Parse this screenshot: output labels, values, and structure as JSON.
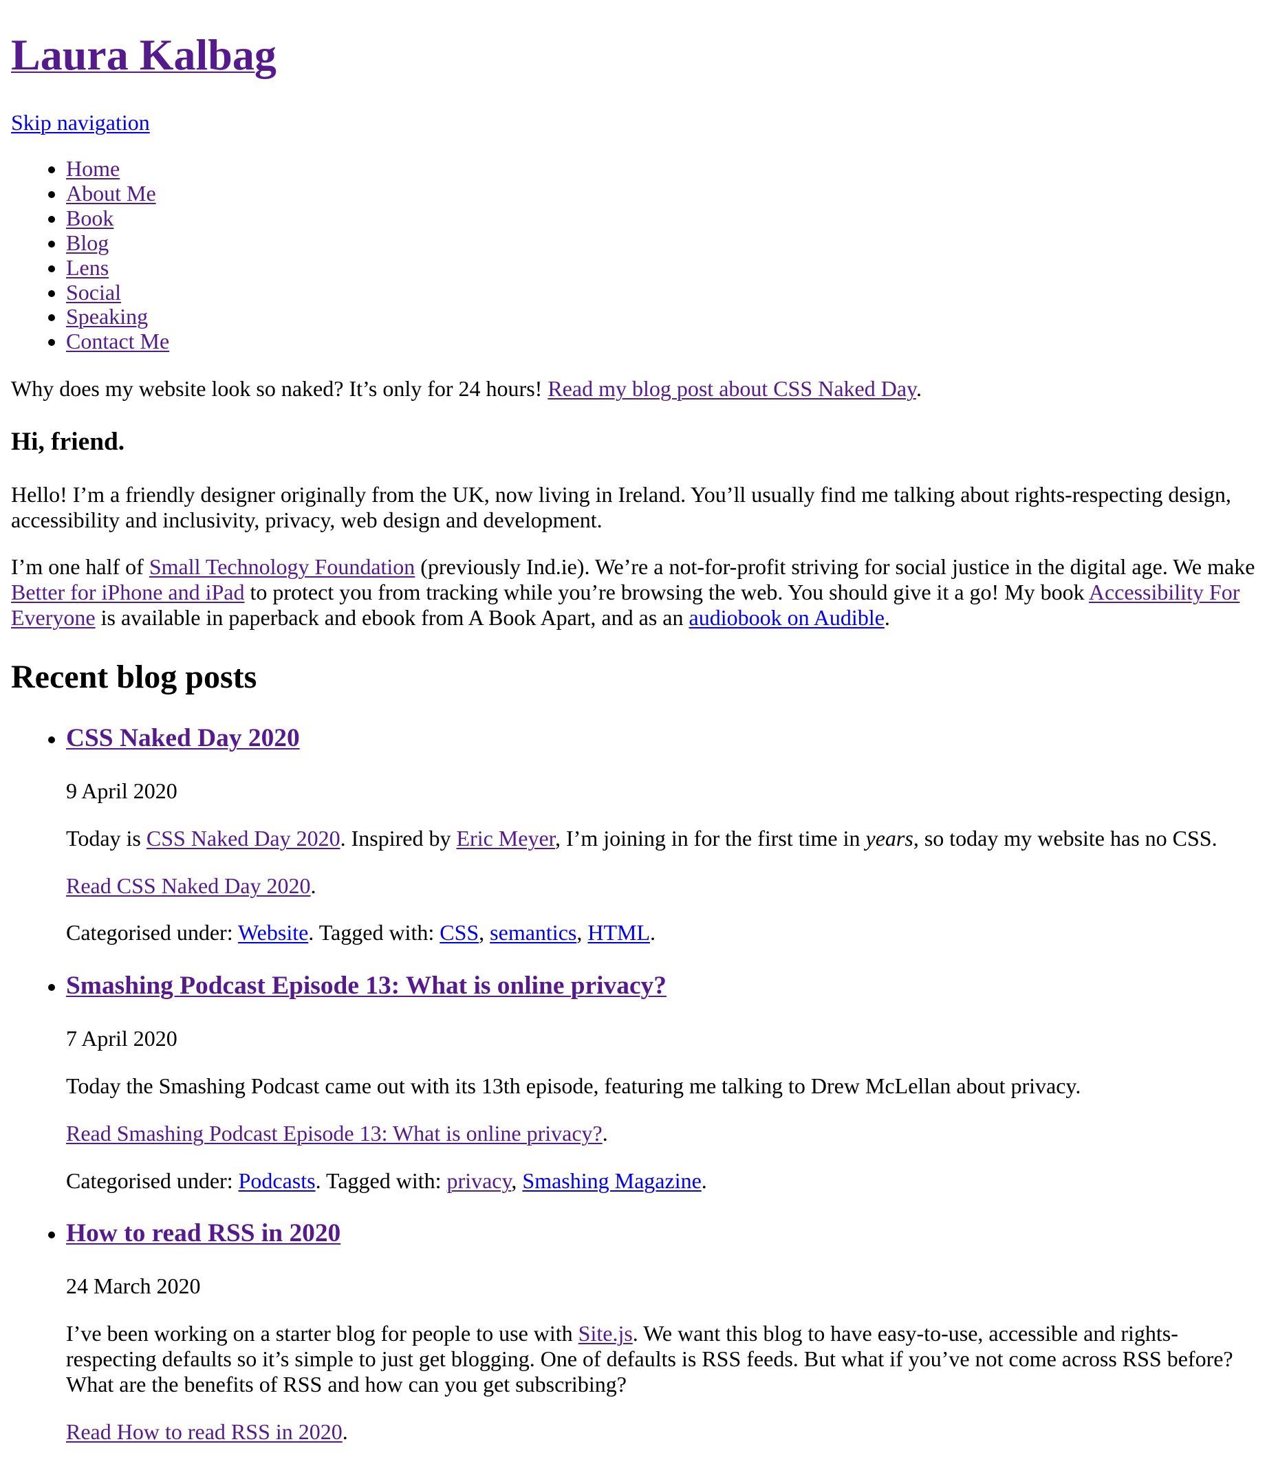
{
  "site": {
    "title": "Laura Kalbag",
    "skip_navigation": "Skip navigation"
  },
  "colors": {
    "visited_link": "#551a8b",
    "unvisited_link": "#0000ee",
    "text": "#000000",
    "background": "#ffffff"
  },
  "nav": {
    "items": [
      {
        "label": "Home"
      },
      {
        "label": "About Me"
      },
      {
        "label": "Book"
      },
      {
        "label": "Blog"
      },
      {
        "label": "Lens"
      },
      {
        "label": "Social"
      },
      {
        "label": "Speaking"
      },
      {
        "label": "Contact Me"
      }
    ]
  },
  "naked_notice": {
    "text": "Why does my website look so naked? It’s only for 24 hours! ",
    "link": "Read my blog post about CSS Naked Day",
    "end": "."
  },
  "intro": {
    "heading": "Hi, friend.",
    "para1": "Hello! I’m a friendly designer originally from the UK, now living in Ireland. You’ll usually find me talking about rights-respecting design, accessibility and inclusivity, privacy, web design and development.",
    "para2": {
      "t1": "I’m one half of ",
      "link1": "Small Technology Foundation",
      "t2": " (previously Ind.ie). We’re a not-for-profit striving for social justice in the digital age. We make ",
      "link2": "Better for iPhone and iPad",
      "t3": " to protect you from tracking while you’re browsing the web. You should give it a go! My book ",
      "link3": "Accessibility For Everyone",
      "t4": " is available in paperback and ebook from A Book Apart, and as an ",
      "link4": "audiobook on Audible",
      "t5": "."
    }
  },
  "recent": {
    "heading": "Recent blog posts",
    "categorised_label": "Categorised under: ",
    "tagged_label": ". Tagged with: ",
    "posts": [
      {
        "title": "CSS Naked Day 2020",
        "date": "9 April 2020",
        "excerpt": {
          "t1": "Today is ",
          "link1": "CSS Naked Day 2020",
          "t2": ". Inspired by ",
          "link2": "Eric Meyer",
          "t3": ", I’m joining in for the first time in ",
          "em": "years",
          "t4": ", so today my website has no CSS."
        },
        "read_more": "Read CSS Naked Day 2020",
        "category": "Website",
        "tags": [
          "CSS",
          "semantics",
          "HTML"
        ]
      },
      {
        "title": "Smashing Podcast Episode 13: What is online privacy?",
        "date": "7 April 2020",
        "excerpt": {
          "t1": "Today the Smashing Podcast came out with its 13th episode, featuring me talking to Drew McLellan about privacy."
        },
        "read_more": "Read Smashing Podcast Episode 13: What is online privacy?",
        "category": "Podcasts",
        "tags": [
          "privacy",
          "Smashing Magazine"
        ]
      },
      {
        "title": "How to read RSS in 2020",
        "date": "24 March 2020",
        "excerpt": {
          "t1": "I’ve been working on a starter blog for people to use with ",
          "link1": "Site.js",
          "t2": ". We want this blog to have easy-to-use, accessible and rights-respecting defaults so it’s simple to just get blogging. One of defaults is RSS feeds. But what if you’ve not come across RSS before? What are the benefits of RSS and how can you get subscribing?"
        },
        "read_more": "Read How to read RSS in 2020"
      }
    ]
  },
  "punct": {
    "period": ".",
    "comma": ", "
  }
}
